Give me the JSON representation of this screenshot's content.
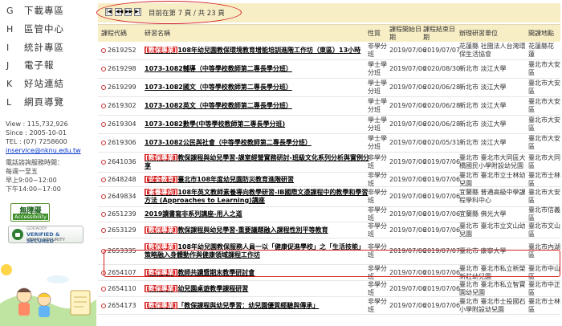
{
  "sidebar": {
    "nav": [
      {
        "key": "G",
        "label": "下載專區"
      },
      {
        "key": "H",
        "label": "區管中心"
      },
      {
        "key": "I",
        "label": "統計專區"
      },
      {
        "key": "J",
        "label": "電子報"
      },
      {
        "key": "K",
        "label": "好站連結"
      },
      {
        "key": "L",
        "label": "網頁導覽"
      }
    ],
    "stats": {
      "view": "View : 115,732,926",
      "since": "Since : 2005-10-01",
      "tel": "TEL : (07) 7258600",
      "email": "inservice@nknu.edu.tw"
    },
    "hours": {
      "title": "電話諮詢服務時間：",
      "days": "每週一至五",
      "am": "早上9:00~12:00",
      "pm": "下午14:00~17:00"
    },
    "accessibility": {
      "title": "無障礙",
      "sub": "Accessibility"
    },
    "seal": {
      "top": "GODADDY",
      "main": "VERIFIED & SECURED",
      "sub": "VERIFY SECURITY"
    }
  },
  "pager": {
    "buttons": [
      "|◀",
      "◀◀",
      "▶▶",
      "▶|"
    ],
    "text": "目前在第 7 頁 / 共 23 頁"
  },
  "table": {
    "headers": {
      "code": "課程代碼",
      "name": "研習名稱",
      "type": "性質",
      "start": "課程開始日期",
      "end": "課程結束日期",
      "org": "辦理研習單位",
      "loc": "開課地點"
    },
    "rows": [
      {
        "code": "2619252",
        "tag": "[教保專業]",
        "name": "108年幼兒園教保環境教育增能培訓進階工作坊（東區）13小時",
        "type": "非學分班",
        "start": "2019/07/06",
        "end": "2019/07/07",
        "org": "花蓮縣 社團法人台灣環保生活協會",
        "loc": "花蓮縣花　蓮"
      },
      {
        "code": "2619298",
        "tag": "",
        "name": "1073-1082輔導（中等學校教師第二專長學分班）",
        "type": "學士學分班",
        "start": "2019/07/06",
        "end": "2020/08/30",
        "org": "新北市 淡江大學",
        "loc": "臺北市大安區"
      },
      {
        "code": "2619299",
        "tag": "",
        "name": "1073-1082國文（中等學校教師第二專長學分班）",
        "type": "學士學分班",
        "start": "2019/07/06",
        "end": "2020/06/28",
        "org": "新北市 淡江大學",
        "loc": "臺北市大安區"
      },
      {
        "code": "2619302",
        "tag": "",
        "name": "1073-1082英文（中等學校教師第二專長學分班）",
        "type": "學士學分班",
        "start": "2019/07/06",
        "end": "2020/06/28",
        "org": "新北市 淡江大學",
        "loc": "臺北市大安區"
      },
      {
        "code": "2619304",
        "tag": "",
        "name": "1073-1082數學(中等學校教師第二專長學分班)",
        "type": "學士學分班",
        "start": "2019/07/06",
        "end": "2020/06/28",
        "org": "新北市 淡江大學",
        "loc": "臺北市大安區"
      },
      {
        "code": "2619306",
        "tag": "",
        "name": "1073-1082公民與社會（中等學校教師第二專長學分班）",
        "type": "學士學分班",
        "start": "2019/07/06",
        "end": "2020/05/31",
        "org": "新北市 淡江大學",
        "loc": "臺北市大安區"
      },
      {
        "code": "2641036",
        "tag": "[教保專業]",
        "name": "教保課程與幼兒學習-課室經營實務研討-班級文化系列分析與實例分享",
        "type": "非學分班",
        "start": "2019/07/06",
        "end": "2019/07/06",
        "org": "臺北市 臺北市大同區大橋國民小學附設幼兒園",
        "loc": "臺北市大同區"
      },
      {
        "code": "2648248",
        "tag": "[安全教育]",
        "name": "臺北市108年度幼兒園防災教育進階研習",
        "type": "非學分班",
        "start": "2019/07/06",
        "end": "2019/07/06",
        "org": "臺北市 臺北市立士林幼兒園",
        "loc": "臺北市士林區"
      },
      {
        "code": "2649834",
        "tag": "[素養導向]",
        "name": "108年英文教師素養導向教學研習-IB國際文憑課程中的教學和學習方法 (Approaches to Learning)講座",
        "type": "非學分班",
        "start": "2019/07/06",
        "end": "2019/07/06",
        "org": "宜蘭縣 普通高級中學課程學科中心",
        "loc": "臺北市大安區"
      },
      {
        "code": "2651239",
        "tag": "",
        "name": "2019讀書寫非系列講座-用人之道",
        "type": "非學分班",
        "start": "2019/07/06",
        "end": "2019/07/06",
        "org": "宜蘭縣 佛光大學",
        "loc": "臺北市信義區"
      },
      {
        "code": "2653129",
        "tag": "[教保專業]",
        "name": "教保課程與幼兒學習-重要議題融入課程性別平等教育",
        "type": "非學分班",
        "start": "2019/07/06",
        "end": "2019/07/06",
        "org": "臺北市 臺北市立文山幼兒園",
        "loc": "臺北市文山區"
      },
      {
        "code": "2653335",
        "tag": "[教保專業]",
        "name": "108年幼兒園教保服務人員一以「健康促進學校」之「生活技能」策略融入身體動作與健康領域課程工作坊",
        "type": "非學分班",
        "start": "2019/07/06",
        "end": "2019/07/07",
        "org": "臺北市 康寧大學",
        "loc": "臺北市內湖區"
      },
      {
        "code": "2654107",
        "tag": "[教保專業]",
        "name": "教師共讀暨期末教學研討會",
        "type": "非學分班",
        "start": "2019/07/06",
        "end": "2019/07/06",
        "org": "臺北市 臺北市私立新榮新莊幼兒園",
        "loc": "臺北市中山區"
      },
      {
        "code": "2654110",
        "tag": "[教保專業]",
        "name": "幼兒園桌遊教學課程研習",
        "type": "非學分班",
        "start": "2019/07/06",
        "end": "2019/07/06",
        "org": "臺北市 臺北市私立智寶園幼兒園",
        "loc": "臺北市中正區"
      },
      {
        "code": "2654173",
        "tag": "[教保專業]",
        "name": "「教保課程與幼兒學習：幼兒園優質經驗與傳承」",
        "type": "非學分班",
        "start": "2019/07/06",
        "end": "2019/07/06",
        "org": "臺北市 臺北市士投國石小學附設幼兒園",
        "loc": "臺北市士林區"
      }
    ]
  }
}
